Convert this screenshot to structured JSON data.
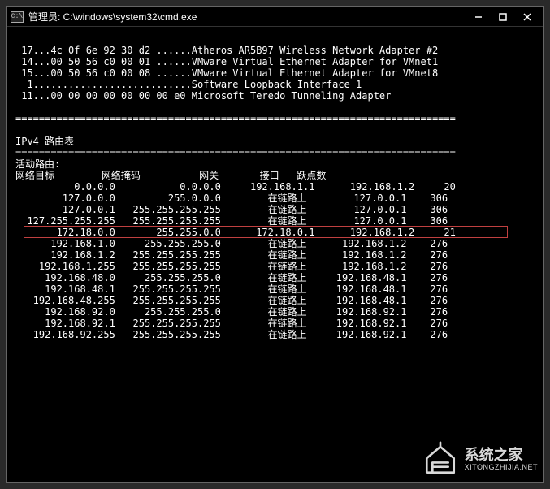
{
  "window": {
    "title_prefix": "管理员: ",
    "title_path": "C:\\windows\\system32\\cmd.exe",
    "icon_label": "C:\\"
  },
  "adapters": [
    {
      "idx": "17",
      "mac": "...4c 0f 6e 92 30 d2 ......",
      "name": "Atheros AR5B97 Wireless Network Adapter #2"
    },
    {
      "idx": "14",
      "mac": "...00 50 56 c0 00 01 ......",
      "name": "VMware Virtual Ethernet Adapter for VMnet1"
    },
    {
      "idx": "15",
      "mac": "...00 50 56 c0 00 08 ......",
      "name": "VMware Virtual Ethernet Adapter for VMnet8"
    },
    {
      "idx": " 1",
      "mac": "...........................",
      "name": "Software Loopback Interface 1"
    },
    {
      "idx": "11",
      "mac": "...00 00 00 00 00 00 00 e0 ",
      "name": "Microsoft Teredo Tunneling Adapter"
    }
  ],
  "section_title": "IPv4 路由表",
  "active_routes_label": "活动路由:",
  "headers": {
    "dest": "网络目标",
    "mask": "网络掩码",
    "gateway": "网关",
    "iface": "接口",
    "metric": "跃点数"
  },
  "on_link": "在链路上",
  "routes": [
    {
      "dest": "0.0.0.0",
      "mask": "0.0.0.0",
      "gateway": "192.168.1.1",
      "iface": "192.168.1.2",
      "metric": "20",
      "highlight": false
    },
    {
      "dest": "127.0.0.0",
      "mask": "255.0.0.0",
      "gateway": "@onlink",
      "iface": "127.0.0.1",
      "metric": "306",
      "highlight": false
    },
    {
      "dest": "127.0.0.1",
      "mask": "255.255.255.255",
      "gateway": "@onlink",
      "iface": "127.0.0.1",
      "metric": "306",
      "highlight": false
    },
    {
      "dest": "127.255.255.255",
      "mask": "255.255.255.255",
      "gateway": "@onlink",
      "iface": "127.0.0.1",
      "metric": "306",
      "highlight": false
    },
    {
      "dest": "172.18.0.0",
      "mask": "255.255.0.0",
      "gateway": "172.18.0.1",
      "iface": "192.168.1.2",
      "metric": "21",
      "highlight": true
    },
    {
      "dest": "192.168.1.0",
      "mask": "255.255.255.0",
      "gateway": "@onlink",
      "iface": "192.168.1.2",
      "metric": "276",
      "highlight": false
    },
    {
      "dest": "192.168.1.2",
      "mask": "255.255.255.255",
      "gateway": "@onlink",
      "iface": "192.168.1.2",
      "metric": "276",
      "highlight": false
    },
    {
      "dest": "192.168.1.255",
      "mask": "255.255.255.255",
      "gateway": "@onlink",
      "iface": "192.168.1.2",
      "metric": "276",
      "highlight": false
    },
    {
      "dest": "192.168.48.0",
      "mask": "255.255.255.0",
      "gateway": "@onlink",
      "iface": "192.168.48.1",
      "metric": "276",
      "highlight": false
    },
    {
      "dest": "192.168.48.1",
      "mask": "255.255.255.255",
      "gateway": "@onlink",
      "iface": "192.168.48.1",
      "metric": "276",
      "highlight": false
    },
    {
      "dest": "192.168.48.255",
      "mask": "255.255.255.255",
      "gateway": "@onlink",
      "iface": "192.168.48.1",
      "metric": "276",
      "highlight": false
    },
    {
      "dest": "192.168.92.0",
      "mask": "255.255.255.0",
      "gateway": "@onlink",
      "iface": "192.168.92.1",
      "metric": "276",
      "highlight": false
    },
    {
      "dest": "192.168.92.1",
      "mask": "255.255.255.255",
      "gateway": "@onlink",
      "iface": "192.168.92.1",
      "metric": "276",
      "highlight": false
    },
    {
      "dest": "192.168.92.255",
      "mask": "255.255.255.255",
      "gateway": "@onlink",
      "iface": "192.168.92.1",
      "metric": "276",
      "highlight": false
    }
  ],
  "watermark": {
    "main": "系统之家",
    "sub": "XITONGZHIJIA.NET"
  }
}
